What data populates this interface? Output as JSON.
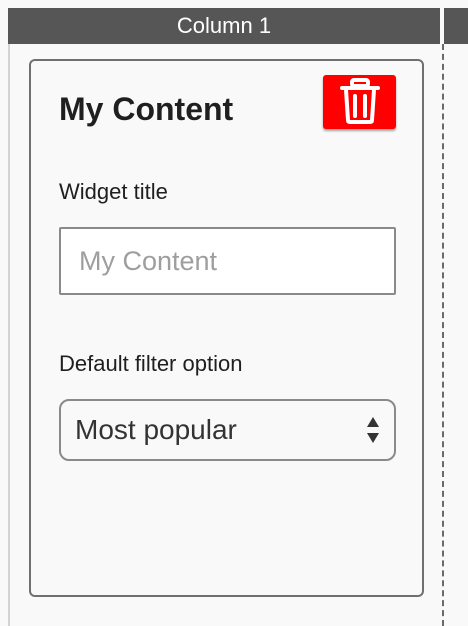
{
  "column": {
    "header": "Column 1"
  },
  "widget": {
    "title": "My Content",
    "delete_icon": "trash-icon",
    "colors": {
      "delete_button": "#ff0000",
      "header_bg": "#565656"
    },
    "fields": {
      "title_label": "Widget title",
      "title_placeholder": "My Content",
      "filter_label": "Default filter option",
      "filter_selected": "Most popular"
    }
  }
}
